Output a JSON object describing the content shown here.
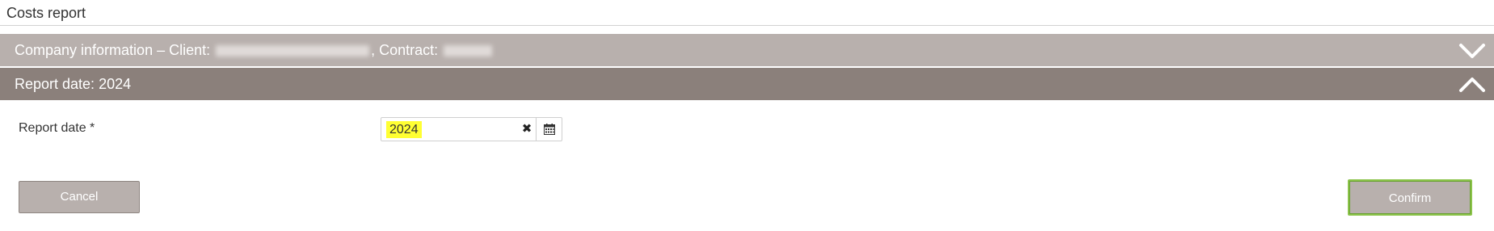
{
  "page": {
    "title": "Costs report"
  },
  "company_panel": {
    "label_prefix": "Company information – Client:",
    "contract_label": ", Contract:",
    "state": "collapsed",
    "toggle_icon": "chevron-down-icon",
    "client_value_hidden": true,
    "contract_value_hidden": true
  },
  "report_panel": {
    "label": "Report date: 2024",
    "state": "expanded",
    "toggle_icon": "chevron-up-icon"
  },
  "report_date_field": {
    "label": "Report date *",
    "value": "2024",
    "clear_icon": "clear-icon",
    "calendar_icon": "calendar-icon",
    "value_highlight_color": "#ffff33"
  },
  "buttons": {
    "cancel_label": "Cancel",
    "confirm_label": "Confirm"
  },
  "colors": {
    "company_header": "#b8b0ad",
    "report_header": "#8b807b",
    "button_bg": "#b8b0ad",
    "confirm_focus_outline": "#8bc34a"
  }
}
